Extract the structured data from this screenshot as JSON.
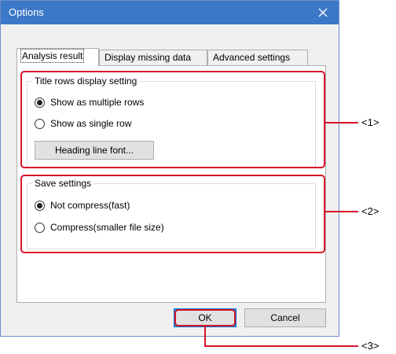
{
  "window": {
    "title": "Options"
  },
  "tabs": [
    {
      "label": "Analysis result",
      "active": true
    },
    {
      "label": "Display missing data",
      "active": false
    },
    {
      "label": "Advanced settings",
      "active": false
    }
  ],
  "title_rows_group": {
    "legend": "Title rows display setting",
    "options": [
      {
        "label": "Show as multiple rows",
        "checked": true
      },
      {
        "label": "Show as single row",
        "checked": false
      }
    ],
    "font_button_label": "Heading line font..."
  },
  "save_group": {
    "legend": "Save settings",
    "options": [
      {
        "label": "Not compress(fast)",
        "checked": true
      },
      {
        "label": "Compress(smaller file size)",
        "checked": false
      }
    ]
  },
  "buttons": {
    "ok_label": "OK",
    "cancel_label": "Cancel"
  },
  "callouts": {
    "c1": "<1>",
    "c2": "<2>",
    "c3": "<3>"
  },
  "colors": {
    "titlebar": "#3c78c8",
    "highlight": "#d8132a",
    "default_button_border": "#0078d7"
  },
  "icons": {
    "close": "close-icon"
  }
}
